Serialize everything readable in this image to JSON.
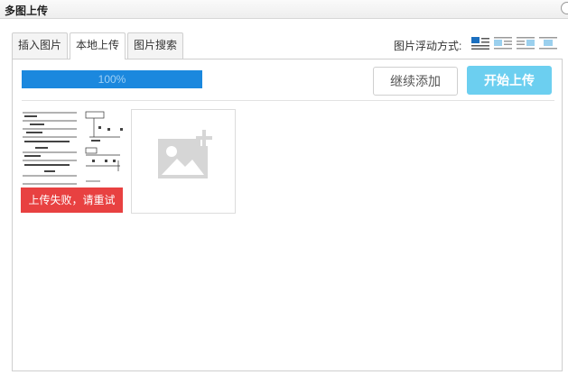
{
  "window": {
    "title": "多图上传"
  },
  "tabs": [
    {
      "label": "插入图片",
      "active": false
    },
    {
      "label": "本地上传",
      "active": true
    },
    {
      "label": "图片搜索",
      "active": false
    }
  ],
  "float_options": {
    "label": "图片浮动方式:",
    "icons": [
      "align-none-icon",
      "align-left-icon",
      "align-right-icon",
      "align-center-icon"
    ],
    "selected": "align-none-icon"
  },
  "upload": {
    "progress_percent": 100,
    "progress_label": "100%",
    "continue_label": "继续添加",
    "start_label": "开始上传",
    "error_message": "上传失败，请重试"
  },
  "colors": {
    "progress": "#1b88de",
    "start_button": "#6ccff0",
    "error": "#e84141"
  }
}
